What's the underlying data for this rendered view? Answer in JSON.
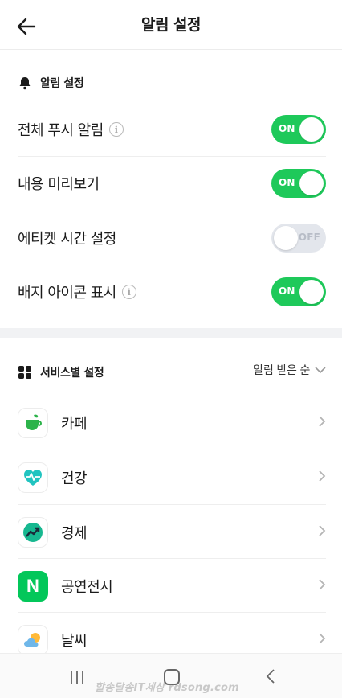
{
  "header": {
    "title": "알림 설정",
    "back_icon": "arrow-left-icon"
  },
  "notify_section": {
    "title": "알림 설정",
    "icon": "bell-icon",
    "rows": [
      {
        "label": "전체 푸시 알림",
        "has_info": true,
        "state": "ON"
      },
      {
        "label": "내용 미리보기",
        "has_info": false,
        "state": "ON"
      },
      {
        "label": "에티켓 시간 설정",
        "has_info": false,
        "state": "OFF"
      },
      {
        "label": "배지 아이콘 표시",
        "has_info": true,
        "state": "ON"
      }
    ]
  },
  "services_section": {
    "title": "서비스별 설정",
    "icon": "grid-icon",
    "sort_label": "알림 받은 순",
    "items": [
      {
        "label": "카페",
        "icon": "cafe-cup-icon"
      },
      {
        "label": "건강",
        "icon": "health-heart-icon"
      },
      {
        "label": "경제",
        "icon": "economy-chart-icon"
      },
      {
        "label": "공연전시",
        "icon": "naver-n-icon",
        "icon_text": "N"
      },
      {
        "label": "날씨",
        "icon": "weather-cloud-sun-icon"
      }
    ]
  },
  "nav_bar": {
    "recent_icon": "recent-apps-icon",
    "home_icon": "home-icon",
    "back_icon": "back-chevron-icon"
  },
  "watermark": "할송달송IT세상 rdsong.com",
  "colors": {
    "toggle_on": "#1ec95a",
    "toggle_off": "#e3e6ec",
    "naver_green": "#03c75a"
  }
}
